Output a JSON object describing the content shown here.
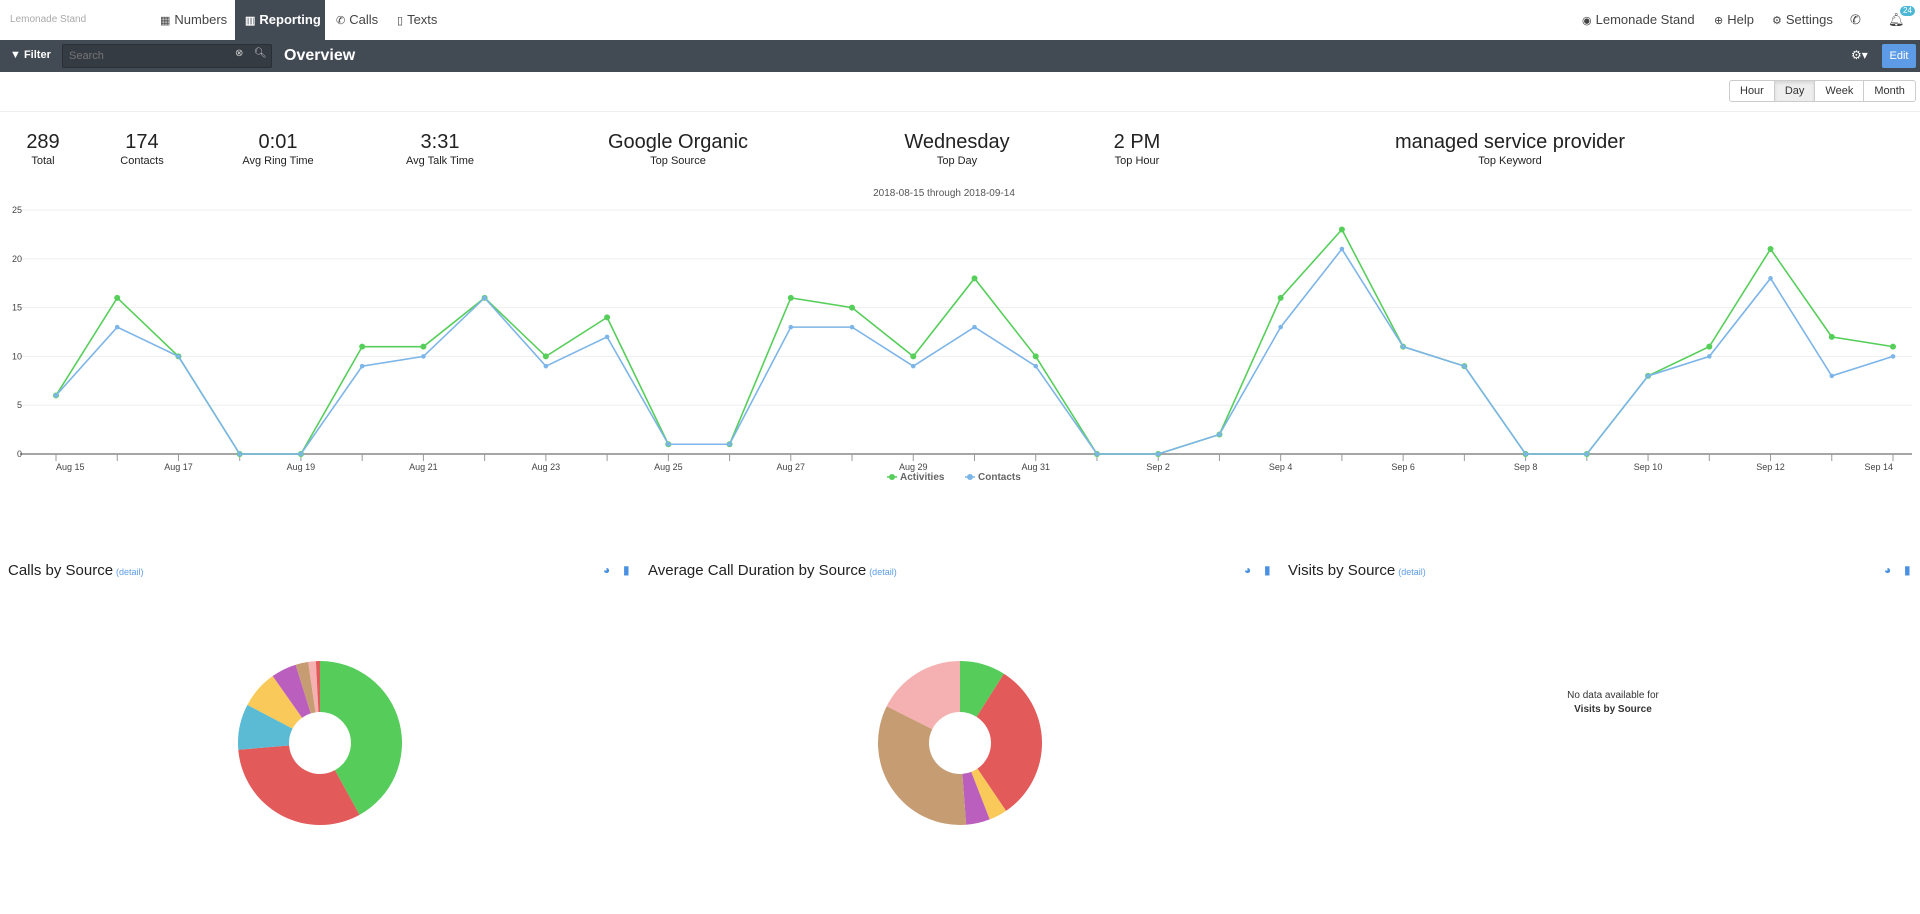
{
  "nav": {
    "logo": "Lemonade Stand",
    "items": [
      {
        "label": "Numbers",
        "icon": "grid-icon"
      },
      {
        "label": "Reporting",
        "icon": "chart-icon",
        "active": true
      },
      {
        "label": "Calls",
        "icon": "phone-icon"
      },
      {
        "label": "Texts",
        "icon": "mobile-icon"
      }
    ],
    "right": [
      {
        "label": "Lemonade Stand",
        "icon": "eye-icon"
      },
      {
        "label": "Help",
        "icon": "lifebuoy-icon"
      },
      {
        "label": "Settings",
        "icon": "gear-icon"
      }
    ],
    "notification_count": "24"
  },
  "subbar": {
    "filter_label": "Filter",
    "search_placeholder": "Search",
    "title": "Overview",
    "edit_label": "Edit"
  },
  "range": {
    "options": [
      "Hour",
      "Day",
      "Week",
      "Month"
    ],
    "selected": "Day"
  },
  "stats": [
    {
      "value": "289",
      "label": "Total"
    },
    {
      "value": "174",
      "label": "Contacts"
    },
    {
      "value": "0:01",
      "label": "Avg Ring Time"
    },
    {
      "value": "3:31",
      "label": "Avg Talk Time"
    },
    {
      "value": "Google Organic",
      "label": "Top Source"
    },
    {
      "value": "Wednesday",
      "label": "Top Day"
    },
    {
      "value": "2 PM",
      "label": "Top Hour"
    },
    {
      "value": "managed service provider",
      "label": "Top Keyword"
    }
  ],
  "chart_data": [
    {
      "type": "line",
      "title": "2018-08-15 through 2018-09-14",
      "x": [
        "Aug 15",
        "Aug 16",
        "Aug 17",
        "Aug 18",
        "Aug 19",
        "Aug 20",
        "Aug 21",
        "Aug 22",
        "Aug 23",
        "Aug 24",
        "Aug 25",
        "Aug 26",
        "Aug 27",
        "Aug 28",
        "Aug 29",
        "Aug 30",
        "Aug 31",
        "Sep 1",
        "Sep 2",
        "Sep 3",
        "Sep 4",
        "Sep 5",
        "Sep 6",
        "Sep 7",
        "Sep 8",
        "Sep 9",
        "Sep 10",
        "Sep 11",
        "Sep 12",
        "Sep 13",
        "Sep 14"
      ],
      "x_tick_labels": [
        "Aug 15",
        "Aug 17",
        "Aug 19",
        "Aug 21",
        "Aug 23",
        "Aug 25",
        "Aug 27",
        "Aug 29",
        "Aug 31",
        "Sep 2",
        "Sep 4",
        "Sep 6",
        "Sep 8",
        "Sep 10",
        "Sep 12",
        "Sep 14"
      ],
      "y_ticks": [
        0,
        5,
        10,
        15,
        20,
        25
      ],
      "ylim": [
        0,
        25
      ],
      "grid": true,
      "legend": "bottom",
      "series": [
        {
          "name": "Activities",
          "color": "#56ce5a",
          "values": [
            6,
            16,
            10,
            0,
            0,
            11,
            11,
            16,
            10,
            14,
            1,
            1,
            16,
            15,
            10,
            18,
            10,
            0,
            0,
            2,
            16,
            23,
            11,
            9,
            0,
            0,
            8,
            11,
            21,
            12,
            11
          ]
        },
        {
          "name": "Contacts",
          "color": "#7db5e8",
          "values": [
            6,
            13,
            10,
            0,
            0,
            9,
            10,
            16,
            9,
            12,
            1,
            1,
            13,
            13,
            9,
            13,
            9,
            0,
            0,
            2,
            13,
            21,
            11,
            9,
            0,
            0,
            8,
            10,
            18,
            8,
            10
          ]
        }
      ]
    },
    {
      "type": "pie",
      "title": "Calls by Source",
      "values": [
        42,
        31.7,
        9,
        7.5,
        5,
        2.5,
        1.5,
        0.8
      ],
      "colors": [
        "#56cc5a",
        "#e35a5a",
        "#5bbbd4",
        "#f9c95a",
        "#bb5fbf",
        "#c69c72",
        "#f5b1b1",
        "#e35a5a"
      ]
    },
    {
      "type": "pie",
      "title": "Average Call Duration by Source",
      "values": [
        9,
        31.5,
        3.6,
        4.7,
        33.6,
        17.6
      ],
      "colors": [
        "#56cc5a",
        "#e35a5a",
        "#f9c95a",
        "#bb5fbf",
        "#c69c72",
        "#f5b1b1"
      ]
    }
  ],
  "sections": [
    {
      "title": "Calls by Source",
      "detail": "(detail)"
    },
    {
      "title": "Average Call Duration by Source",
      "detail": "(detail)"
    },
    {
      "title": "Visits by Source",
      "detail": "(detail)"
    }
  ],
  "nodata": {
    "line1": "No data available for",
    "line2": "Visits by Source"
  }
}
